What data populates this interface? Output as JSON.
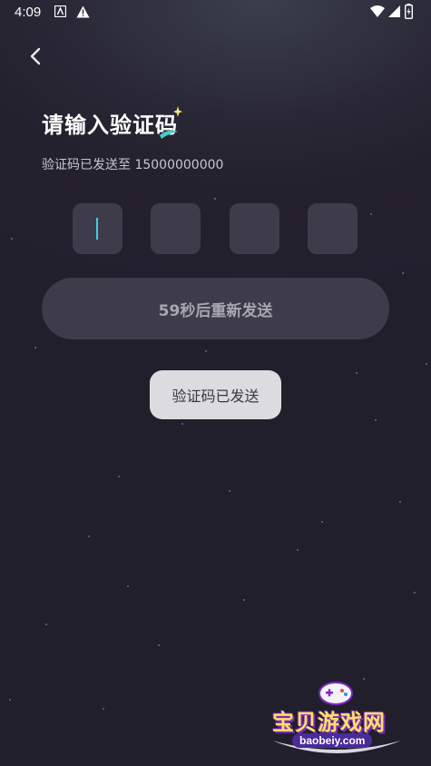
{
  "status_bar": {
    "time": "4:09"
  },
  "page": {
    "title": "请输入验证码",
    "sent_prefix": "验证码已发送至",
    "phone": "15000000000",
    "code_boxes": [
      "",
      "",
      "",
      ""
    ],
    "resend_label": "59秒后重新发送",
    "toast": "验证码已发送"
  },
  "watermark": {
    "name": "宝贝游戏网",
    "url": "baobeiy.com"
  },
  "colors": {
    "background": "#24212f",
    "box": "#3e3c4a",
    "cursor": "#3fd0e0",
    "toast_bg": "#dcdce0"
  }
}
